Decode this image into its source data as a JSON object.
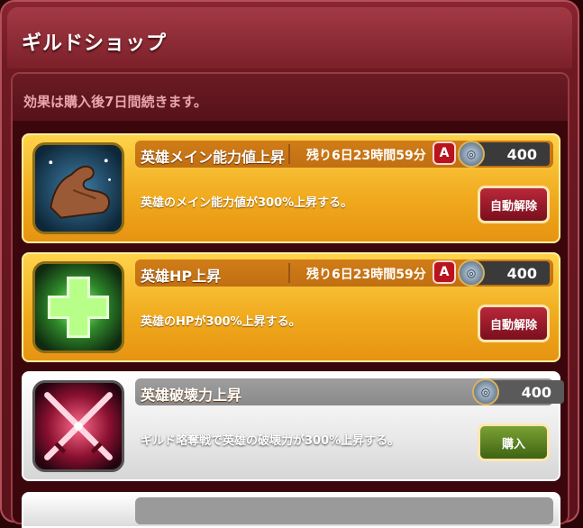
{
  "header": {
    "title": "ギルドショップ"
  },
  "notice": "効果は購入後7日間続きます。",
  "items": [
    {
      "name": "英雄メイン能力値上昇",
      "remaining": "残り6日23時間59分",
      "auto_badge": "A",
      "price": "400",
      "description": "英雄のメイン能力値が300%上昇する。",
      "button": "自動解除",
      "icon": "muscle-arm-icon"
    },
    {
      "name": "英雄HP上昇",
      "remaining": "残り6日23時間59分",
      "auto_badge": "A",
      "price": "400",
      "description": "英雄のHPが300%上昇する。",
      "button": "自動解除",
      "icon": "green-cross-icon"
    },
    {
      "name": "英雄破壊力上昇",
      "price": "400",
      "description": "ギルド略奪戦で英雄の破壊力が300%上昇する。",
      "button": "購入",
      "icon": "crossed-swords-icon"
    }
  ],
  "colors": {
    "gold_card": "#f0a91d",
    "silver_card": "#e9e9e9",
    "cancel_button": "#b8283a",
    "buy_button": "#5f8a22"
  }
}
